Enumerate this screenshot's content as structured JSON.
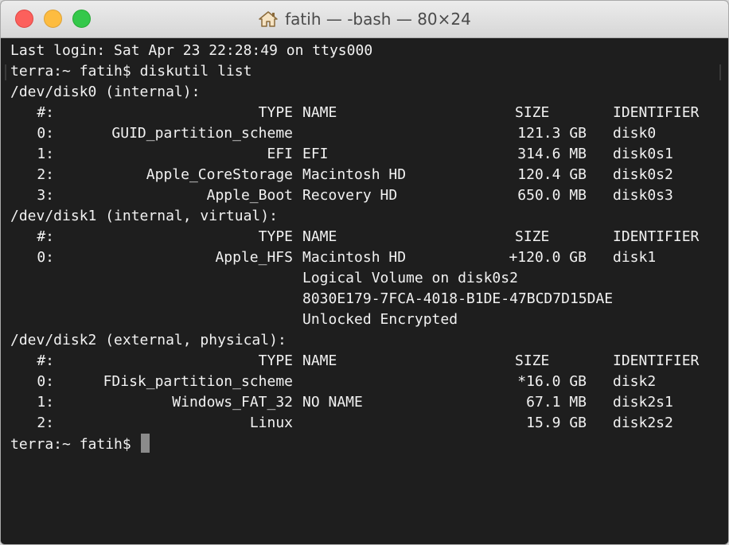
{
  "window": {
    "title": "fatih — -bash — 80×24",
    "buttons": {
      "close": "close",
      "minimize": "minimize",
      "zoom": "zoom"
    }
  },
  "terminal": {
    "last_login": "Last login: Sat Apr 23 22:28:49 on ttys000",
    "prompt": "terra:~ fatih$",
    "command": "diskutil list",
    "headers": {
      "num": "#:",
      "type": "TYPE",
      "name": "NAME",
      "size": "SIZE",
      "identifier": "IDENTIFIER"
    },
    "disks": [
      {
        "device": "/dev/disk0 (internal):",
        "rows": [
          {
            "num": "0:",
            "type": "GUID_partition_scheme",
            "name": "",
            "size": "121.3 GB",
            "id": "disk0"
          },
          {
            "num": "1:",
            "type": "EFI",
            "name": "EFI",
            "size": "314.6 MB",
            "id": "disk0s1"
          },
          {
            "num": "2:",
            "type": "Apple_CoreStorage",
            "name": "Macintosh HD",
            "size": "120.4 GB",
            "id": "disk0s2"
          },
          {
            "num": "3:",
            "type": "Apple_Boot",
            "name": "Recovery HD",
            "size": "650.0 MB",
            "id": "disk0s3"
          }
        ],
        "extra": []
      },
      {
        "device": "/dev/disk1 (internal, virtual):",
        "rows": [
          {
            "num": "0:",
            "type": "Apple_HFS",
            "name": "Macintosh HD",
            "size": "+120.0 GB",
            "id": "disk1"
          }
        ],
        "extra": [
          "Logical Volume on disk0s2",
          "8030E179-7FCA-4018-B1DE-47BCD7D15DAE",
          "Unlocked Encrypted"
        ]
      },
      {
        "device": "/dev/disk2 (external, physical):",
        "rows": [
          {
            "num": "0:",
            "type": "FDisk_partition_scheme",
            "name": "",
            "size": "*16.0 GB",
            "id": "disk2"
          },
          {
            "num": "1:",
            "type": "Windows_FAT_32",
            "name": "NO NAME",
            "size": "67.1 MB",
            "id": "disk2s1"
          },
          {
            "num": "2:",
            "type": "Linux",
            "name": "",
            "size": "15.9 GB",
            "id": "disk2s2"
          }
        ],
        "extra": []
      }
    ]
  }
}
